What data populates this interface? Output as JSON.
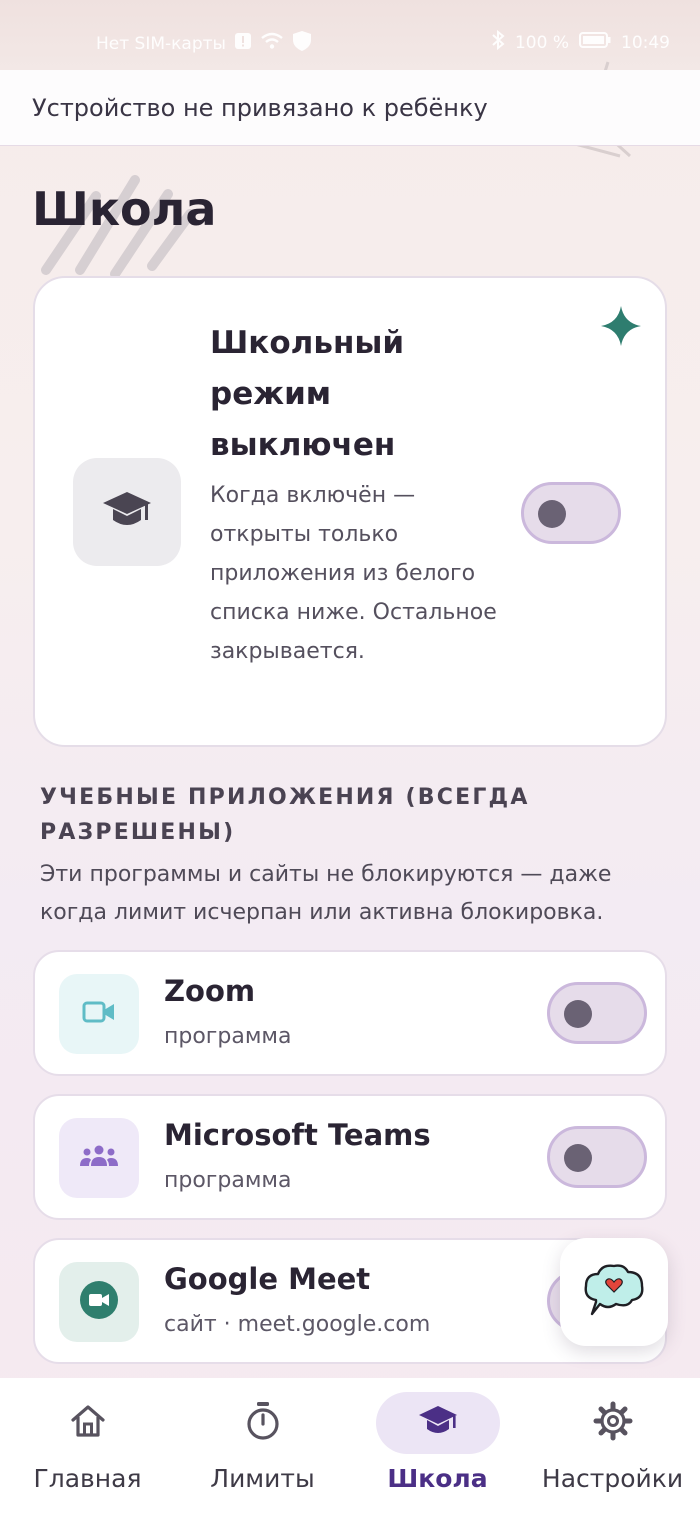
{
  "status_bar": {
    "carrier": "Нет SIM-карты",
    "battery_percent": "100 %",
    "time": "10:49"
  },
  "banner": {
    "text": "Устройство не привязано к ребёнку"
  },
  "page": {
    "title": "Школа"
  },
  "school_mode": {
    "title": "Школьный режим выключен",
    "description": "Когда включён — открыты только приложения из белого списка ниже. Остальное закрывается.",
    "enabled": false,
    "icon": "graduation-cap-icon"
  },
  "section": {
    "title": "УЧЕБНЫЕ ПРИЛОЖЕНИЯ (ВСЕГДА РАЗРЕШЕНЫ)",
    "description": "Эти программы и сайты не блокируются — даже когда лимит исчерпан или активна блокировка."
  },
  "apps": [
    {
      "name": "Zoom",
      "type": "программа",
      "icon": "video-camera-icon",
      "icon_color": "#5fbcc6",
      "icon_bg": "#e8f6f7",
      "enabled": false
    },
    {
      "name": "Microsoft Teams",
      "type": "программа",
      "icon": "people-group-icon",
      "icon_color": "#8d6cc8",
      "icon_bg": "#efe9f8",
      "enabled": false
    },
    {
      "name": "Google Meet",
      "type": "сайт · meet.google.com",
      "icon": "video-call-icon",
      "icon_color": "#2f7f6e",
      "icon_bg": "#e3efeb",
      "enabled": false
    }
  ],
  "bottom_nav": {
    "items": [
      {
        "label": "Главная",
        "icon": "home-icon",
        "active": false
      },
      {
        "label": "Лимиты",
        "icon": "stopwatch-icon",
        "active": false
      },
      {
        "label": "Школа",
        "icon": "graduation-cap-icon",
        "active": true
      },
      {
        "label": "Настройки",
        "icon": "gear-icon",
        "active": false
      }
    ]
  },
  "colors": {
    "accent": "#4b2f86",
    "toggle_track": "#e6dcea",
    "toggle_border": "#cbb8dc",
    "sparkle": "#2e7d6f"
  }
}
